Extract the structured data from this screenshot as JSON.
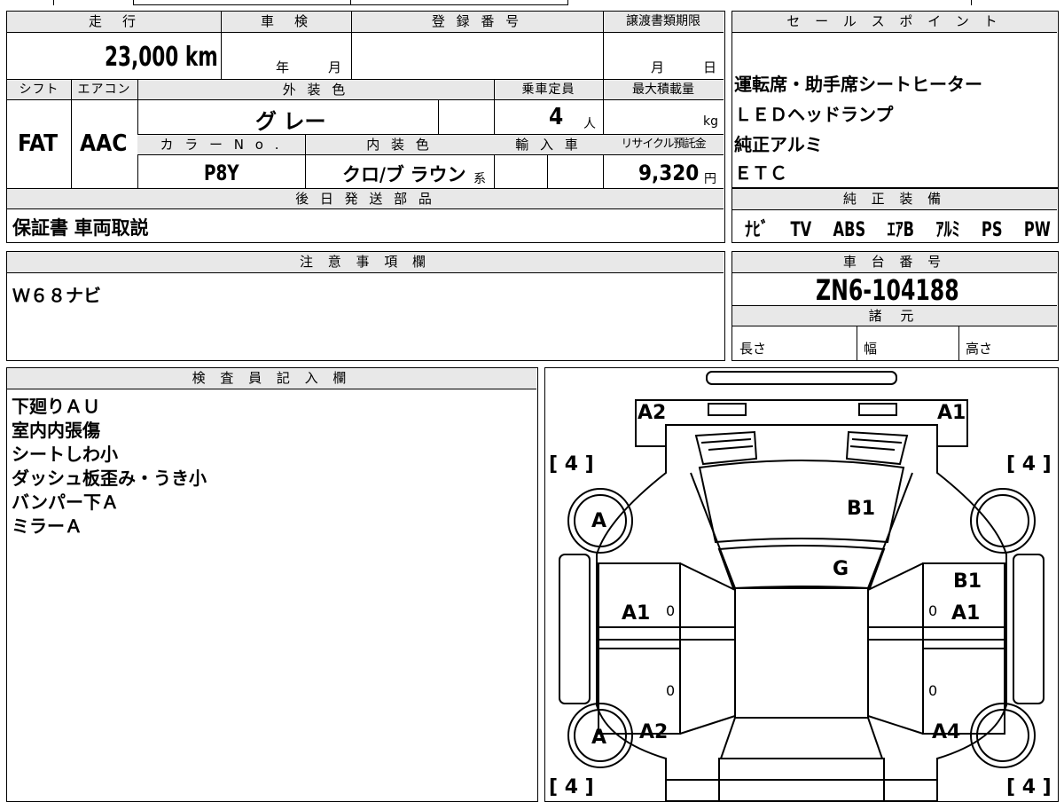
{
  "main": {
    "mileage_header": "走　行",
    "mileage_value": "23,000",
    "mileage_unit": "km",
    "inspection_header": "車　検",
    "inspection_year": "年",
    "inspection_month": "月",
    "registration_header": "登 録 番 号",
    "transfer_header": "譲渡書類期限",
    "transfer_month": "月",
    "transfer_day": "日",
    "shift_header": "シフト",
    "shift_value": "FAT",
    "ac_header": "エアコン",
    "ac_value": "AAC",
    "exterior_header": "外 装 色",
    "exterior_value": "グ レー",
    "color_no_header": "カ ラ ー N o .",
    "color_no_value": "P8Y",
    "interior_header": "内 装 色",
    "interior_value": "クロ/ブ ラウン",
    "interior_suffix": "系",
    "capacity_header": "乗車定員",
    "capacity_value": "4",
    "capacity_unit": "人",
    "import_header": "輸 入 車",
    "max_load_header": "最大積載量",
    "max_load_unit": "kg",
    "recycle_header": "リサイクル預託金",
    "recycle_value": "9,320",
    "recycle_unit": "円",
    "deferred_header": "後 日 発 送 部 品",
    "deferred_value": "保証書 車両取説"
  },
  "sales_points": {
    "header": "セ ー ル ス ポ イ ン ト",
    "items": [
      "運転席・助手席シートヒーター",
      "ＬＥＤヘッドランプ",
      "純正アルミ",
      "ＥＴＣ"
    ]
  },
  "equipment": {
    "header": "純 正 装 備",
    "items": [
      "ﾅﾋﾞ",
      "TV",
      "ABS",
      "ｴｱB",
      "ｱﾙﾐ",
      "PS",
      "PW"
    ]
  },
  "notes": {
    "header": "注 意 事 項 欄",
    "value": "Ｗ６８ナビ"
  },
  "chassis": {
    "header": "車 台 番 号",
    "value": "ZN6-104188",
    "specs_header": "諸 元",
    "length_label": "長さ",
    "width_label": "幅",
    "height_label": "高さ"
  },
  "inspector": {
    "header": "検 査 員 記 入 欄",
    "lines": [
      "下廻りＡＵ",
      "室内内張傷",
      "シートしわ小",
      "ダッシュ板歪み・うき小",
      "バンパー下Ａ",
      "ミラーＡ"
    ]
  },
  "diagram": {
    "tire_tl": "[ 4 ]",
    "tire_tr": "[ 4 ]",
    "tire_bl": "[ 4 ]",
    "tire_br": "[ 4 ]",
    "front_left": "A2",
    "front_right": "A1",
    "hood": "B1",
    "windshield": "G",
    "wheel_fl": "A",
    "wheel_rl": "A",
    "left_front_door": "A1",
    "right_front_panel": "B1",
    "right_front_door": "A1",
    "rear_left": "A2",
    "rear_right": "A4",
    "zero_lf": "0",
    "zero_rf": "0",
    "zero_lr": "0",
    "zero_rr": "0"
  }
}
